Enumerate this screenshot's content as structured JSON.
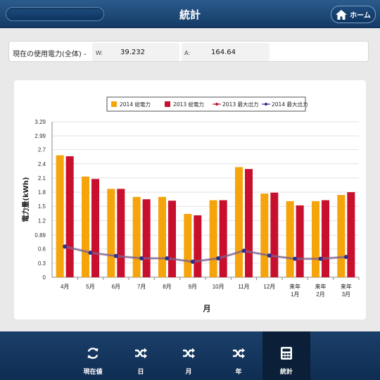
{
  "header": {
    "title": "統計",
    "home_label": "ホーム"
  },
  "usage": {
    "label": "現在の使用電力(全体) -",
    "w_key": "W:",
    "w_value": "39.232",
    "a_key": "A:",
    "a_value": "164.64"
  },
  "chart_data": {
    "type": "bar",
    "categories": [
      "4月",
      "5月",
      "6月",
      "7月",
      "8月",
      "9月",
      "10月",
      "11月",
      "12月",
      [
        "来年",
        "1月"
      ],
      [
        "来年",
        "2月"
      ],
      [
        "来年",
        "3月"
      ]
    ],
    "series": [
      {
        "name": "2014 総電力",
        "type": "bar",
        "color": "#f5a40b",
        "values": [
          2.58,
          2.13,
          1.87,
          1.7,
          1.7,
          1.34,
          1.63,
          2.33,
          1.77,
          1.61,
          1.61,
          1.74
        ]
      },
      {
        "name": "2013 総電力",
        "type": "bar",
        "color": "#c8102e",
        "values": [
          2.56,
          2.08,
          1.87,
          1.65,
          1.62,
          1.31,
          1.63,
          2.29,
          1.79,
          1.52,
          1.63,
          1.8
        ]
      },
      {
        "name": "2013 最大出力",
        "type": "line",
        "color": "#c8102e",
        "values": [
          0.65,
          0.52,
          0.45,
          0.4,
          0.4,
          0.33,
          0.4,
          0.56,
          0.46,
          0.39,
          0.39,
          0.43
        ]
      },
      {
        "name": "2014 最大出力",
        "type": "line",
        "color": "#2b2f8a",
        "values": [
          0.65,
          0.52,
          0.45,
          0.4,
          0.4,
          0.33,
          0.4,
          0.56,
          0.46,
          0.39,
          0.39,
          0.43
        ]
      }
    ],
    "yticks": [
      0,
      0.3,
      0.6,
      0.89,
      1.2,
      1.5,
      1.8,
      2.1,
      2.4,
      2.7,
      2.99,
      3.29
    ],
    "ylim": [
      0,
      3.29
    ],
    "xlabel": "月",
    "ylabel": "電力量(kWh)",
    "legend_position": "top",
    "grid": true
  },
  "tabs": [
    {
      "label": "現在値",
      "icon": "refresh-icon"
    },
    {
      "label": "日",
      "icon": "shuffle-icon"
    },
    {
      "label": "月",
      "icon": "shuffle-icon"
    },
    {
      "label": "年",
      "icon": "shuffle-icon"
    },
    {
      "label": "統計",
      "icon": "calculator-icon",
      "active": true
    }
  ]
}
